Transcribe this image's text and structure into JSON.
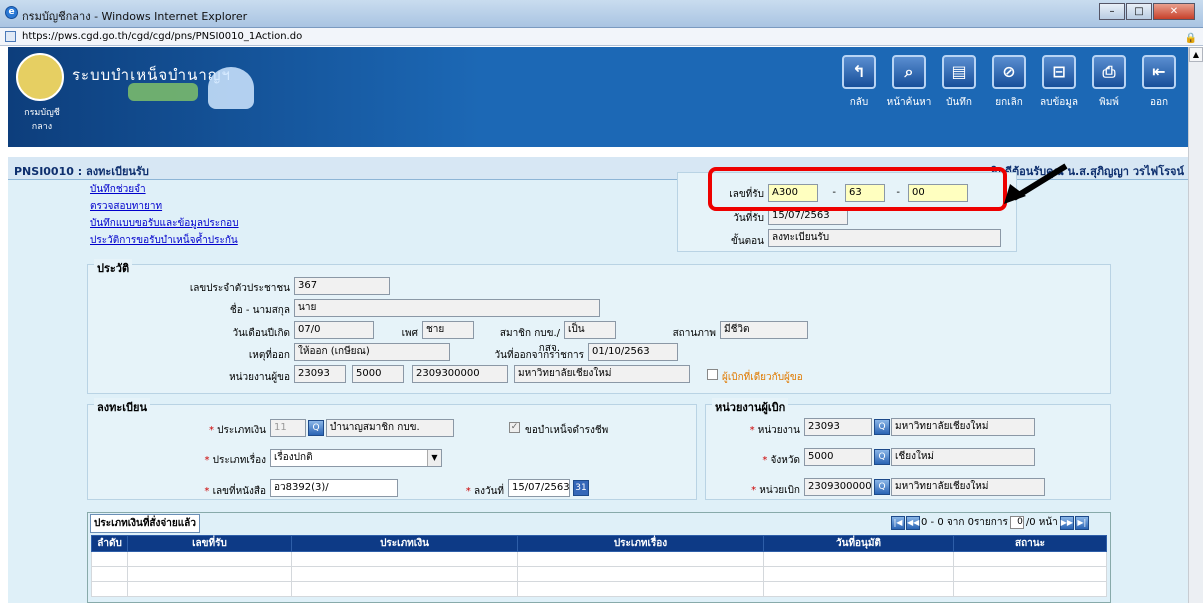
{
  "window": {
    "title": "กรมบัญชีกลาง - Windows Internet Explorer",
    "url": "https://pws.cgd.go.th/cgd/cgd/pns/PNSI0010_1Action.do"
  },
  "banner": {
    "system_name": "ระบบบำเหน็จบำนาญฯ",
    "seal_text": "กรมบัญชีกลาง"
  },
  "toolbar": [
    {
      "label": "กลับ",
      "icon": "back-icon",
      "glyph": "↰"
    },
    {
      "label": "หน้าค้นหา",
      "icon": "search-icon",
      "glyph": "⌕"
    },
    {
      "label": "บันทึก",
      "icon": "save-icon",
      "glyph": "▤"
    },
    {
      "label": "ยกเลิก",
      "icon": "cancel-icon",
      "glyph": "⊘"
    },
    {
      "label": "ลบข้อมูล",
      "icon": "delete-icon",
      "glyph": "⊟"
    },
    {
      "label": "พิมพ์",
      "icon": "print-icon",
      "glyph": "⎙"
    },
    {
      "label": "ออก",
      "icon": "exit-icon",
      "glyph": "⇤"
    }
  ],
  "header": {
    "page_title": "PNSI0010 : ลงทะเบียนรับ",
    "welcome": "ยินดีต้อนรับคุณ น.ส.สุภิญญา วรไฟโรจน์"
  },
  "links": [
    "บันทึกช่วยจำ",
    "ตรวจสอบทายาท",
    "บันทึกแบบขอรับและข้อมูลประกอบ",
    "ประวัติการขอรับบำเหน็จค้ำประกัน"
  ],
  "receipt": {
    "label_no": "เลขที่รับ",
    "no_part1": "A300",
    "no_part2": "63",
    "no_part3": "00",
    "sep": "-",
    "label_date": "วันที่รับ",
    "date": "15/07/2563",
    "label_step": "ขั้นตอน",
    "step": "ลงทะเบียนรับ"
  },
  "history": {
    "title": "ประวัติ",
    "id_label": "เลขประจำตัวประชาชน",
    "id_value": "367",
    "name_label": "ชื่อ - นามสกุล",
    "name_value": "นาย",
    "dob_label": "วันเดือนปีเกิด",
    "dob_value": "07/0",
    "sex_label": "เพศ",
    "sex_value": "ชาย",
    "member_label": "สมาชิก กบข./กสจ.",
    "member_value": "เป็น",
    "status_label": "สถานภาพ",
    "status_value": "มีชีวิต",
    "reason_label": "เหตุที่ออก",
    "reason_value": "ให้ออก (เกษียณ)",
    "retire_date_label": "วันที่ออกจากราชการ",
    "retire_date_value": "01/10/2563",
    "unit_label": "หน่วยงานผู้ขอ",
    "unit_code": "23093",
    "unit_prov": "5000",
    "unit_full": "2309300000",
    "unit_name": "มหาวิทยาลัยเชียงใหม่",
    "same_payer_label": "ผู้เบิกที่เดียวกับผู้ขอ"
  },
  "register": {
    "title": "ลงทะเบียน",
    "money_type_label": "ประเภทเงิน",
    "money_type_code": "11",
    "money_type_name": "บำนาญสมาชิก กบข.",
    "pension_chk_label": "ขอบำเหน็จดำรงชีพ",
    "subject_label": "ประเภทเรื่อง",
    "subject_value": "เรื่องปกติ",
    "doc_no_label": "เลขที่หนังสือ",
    "doc_no_value": "อว8392(3)/",
    "doc_date_label": "ลงวันที่",
    "doc_date_value": "15/07/2563"
  },
  "payer": {
    "title": "หน่วยงานผู้เบิก",
    "unit_label": "หน่วยงาน",
    "unit_code": "23093",
    "unit_name": "มหาวิทยาลัยเชียงใหม่",
    "province_label": "จังหวัด",
    "province_code": "5000",
    "province_name": "เชียงใหม่",
    "payer_label": "หน่วยเบิก",
    "payer_code": "2309300000",
    "payer_name": "มหาวิทยาลัยเชียงใหม่"
  },
  "paid_table": {
    "tab_label": "ประเภทเงินที่สั่งจ่ายแล้ว",
    "pager_text": "0 - 0 จาก 0รายการ",
    "page_value": "0",
    "page_total": "/0 หน้า",
    "columns": [
      "ลำดับ",
      "เลขที่รับ",
      "ประเภทเงิน",
      "ประเภทเรื่อง",
      "วันที่อนุมัติ",
      "สถานะ"
    ]
  }
}
